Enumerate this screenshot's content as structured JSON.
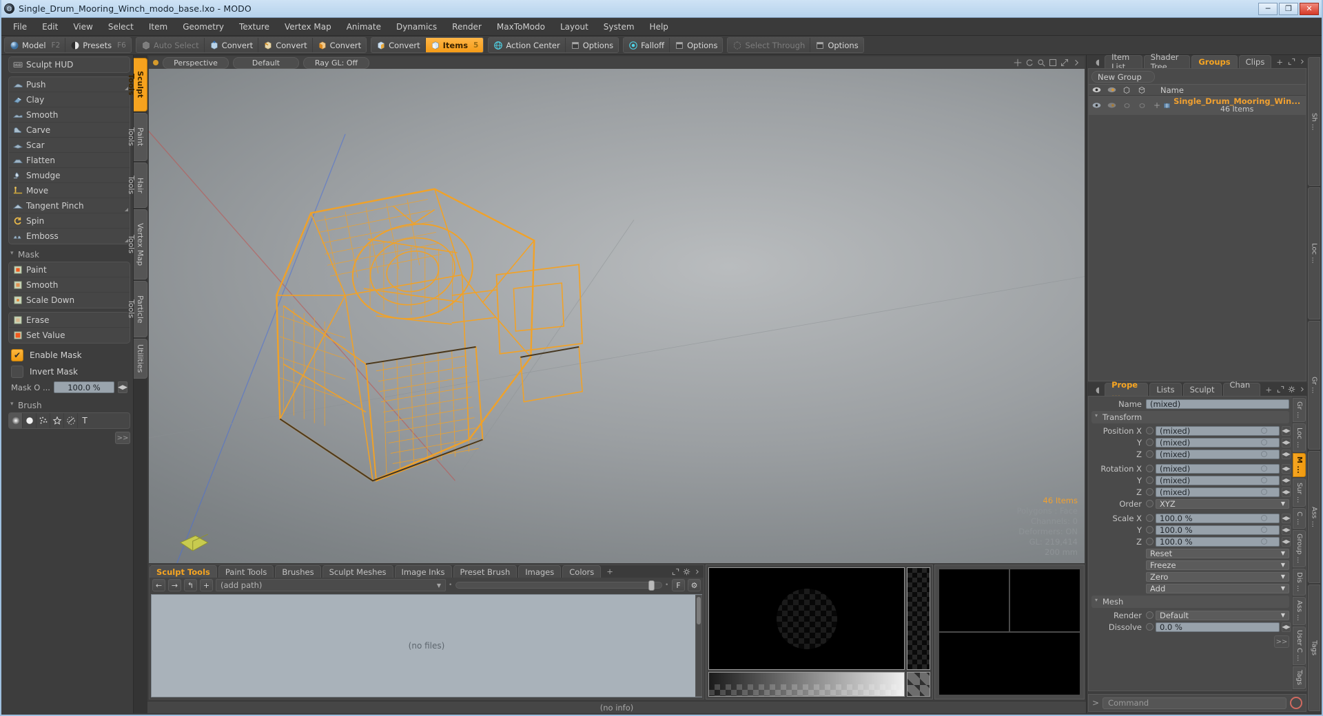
{
  "titlebar": {
    "title": "Single_Drum_Mooring_Winch_modo_base.lxo - MODO",
    "logo_icon": "modo-logo-icon",
    "minimize": "─",
    "maximize": "❐",
    "close": "✕"
  },
  "menubar": {
    "items": [
      "File",
      "Edit",
      "View",
      "Select",
      "Item",
      "Geometry",
      "Texture",
      "Vertex Map",
      "Animate",
      "Dynamics",
      "Render",
      "MaxToModo",
      "Layout",
      "System",
      "Help"
    ]
  },
  "toolbar": {
    "groups": [
      {
        "buttons": [
          {
            "label": "Model",
            "hotkey": "F2",
            "icon": "sphere-blue-icon",
            "state": "normal"
          },
          {
            "label": "Presets",
            "hotkey": "F6",
            "icon": "sphere-half-icon",
            "state": "normal"
          }
        ]
      },
      {
        "buttons": [
          {
            "label": "Auto Select",
            "hotkey": "",
            "icon": "cube-grey-icon",
            "state": "disabled"
          },
          {
            "label": "Convert",
            "hotkey": "",
            "icon": "cube-vertex-icon",
            "state": "normal"
          },
          {
            "label": "Convert",
            "hotkey": "",
            "icon": "cube-edge-icon",
            "state": "normal"
          },
          {
            "label": "Convert",
            "hotkey": "",
            "icon": "cube-poly-icon",
            "state": "normal"
          }
        ]
      },
      {
        "buttons": [
          {
            "label": "Convert",
            "hotkey": "",
            "icon": "cube-item-icon",
            "state": "normal"
          },
          {
            "label": "Items",
            "hotkey": "5",
            "icon": "cube-orange-icon",
            "state": "active"
          }
        ]
      },
      {
        "buttons": [
          {
            "label": "Action Center",
            "hotkey": "",
            "icon": "globe-icon",
            "state": "normal"
          },
          {
            "label": "Options",
            "hotkey": "",
            "icon": "panel-icon",
            "state": "normal"
          }
        ]
      },
      {
        "buttons": [
          {
            "label": "Falloff",
            "hotkey": "",
            "icon": "falloff-icon",
            "state": "normal"
          },
          {
            "label": "Options",
            "hotkey": "",
            "icon": "panel-icon",
            "state": "normal"
          }
        ]
      },
      {
        "buttons": [
          {
            "label": "Select Through",
            "hotkey": "",
            "icon": "select-through-icon",
            "state": "disabled"
          },
          {
            "label": "Options",
            "hotkey": "",
            "icon": "panel-icon",
            "state": "normal"
          }
        ]
      }
    ]
  },
  "left_panel": {
    "hud_button": {
      "label": "Sculpt HUD",
      "icon": "hud-icon"
    },
    "sculpt_tools": [
      {
        "label": "Push",
        "icon": "push-brush-icon",
        "has_corner": true
      },
      {
        "label": "Clay",
        "icon": "clay-brush-icon",
        "has_corner": false
      },
      {
        "label": "Smooth",
        "icon": "smooth-brush-icon",
        "has_corner": false
      },
      {
        "label": "Carve",
        "icon": "carve-brush-icon",
        "has_corner": false
      },
      {
        "label": "Scar",
        "icon": "scar-brush-icon",
        "has_corner": false
      },
      {
        "label": "Flatten",
        "icon": "flatten-brush-icon",
        "has_corner": false
      },
      {
        "label": "Smudge",
        "icon": "smudge-brush-icon",
        "has_corner": false
      },
      {
        "label": "Move",
        "icon": "move-brush-icon",
        "has_corner": false
      },
      {
        "label": "Tangent Pinch",
        "icon": "pinch-brush-icon",
        "has_corner": true
      },
      {
        "label": "Spin",
        "icon": "spin-brush-icon",
        "has_corner": false
      },
      {
        "label": "Emboss",
        "icon": "emboss-brush-icon",
        "has_corner": true
      }
    ],
    "mask_section": {
      "label": "Mask"
    },
    "mask_tools_a": [
      {
        "label": "Paint",
        "icon": "mask-paint-icon"
      },
      {
        "label": "Smooth",
        "icon": "mask-smooth-icon"
      },
      {
        "label": "Scale Down",
        "icon": "mask-scaledown-icon"
      }
    ],
    "mask_tools_b": [
      {
        "label": "Erase",
        "icon": "mask-erase-icon"
      },
      {
        "label": "Set Value",
        "icon": "mask-setvalue-icon"
      }
    ],
    "enable_mask": {
      "label": "Enable Mask",
      "checked": true,
      "check_glyph": "✔"
    },
    "invert_mask": {
      "label": "Invert Mask",
      "checked": false,
      "check_glyph": ""
    },
    "mask_opacity": {
      "label": "Mask O ...",
      "value": "100.0 %"
    },
    "brush_section": {
      "label": "Brush"
    },
    "brush_icons": [
      {
        "name": "soft-falloff-icon",
        "glyph": "●",
        "selected": true
      },
      {
        "name": "hard-falloff-icon",
        "glyph": "⬤",
        "selected": false
      },
      {
        "name": "noise-brush-icon",
        "glyph": "❋",
        "selected": false
      },
      {
        "name": "star-brush-icon",
        "glyph": "☆",
        "selected": false
      },
      {
        "name": "procedural-brush-icon",
        "glyph": "◓",
        "selected": false
      },
      {
        "name": "text-brush-icon",
        "glyph": "T",
        "selected": false
      }
    ],
    "more_button": ">>",
    "vertical_tabs": [
      {
        "label": "Sculpt Tools",
        "active": true
      },
      {
        "label": "Paint Tools",
        "active": false
      },
      {
        "label": "Hair Tools",
        "active": false
      },
      {
        "label": "Vertex Map Tools",
        "active": false
      },
      {
        "label": "Particle Tools",
        "active": false
      },
      {
        "label": "Utilities",
        "active": false
      }
    ]
  },
  "viewport": {
    "header": {
      "dot_icon": "viewport-menu-dot-icon",
      "pills": [
        "Perspective",
        "Default",
        "Ray GL: Off"
      ],
      "icons": [
        "move-view-icon",
        "rotate-view-icon",
        "zoom-view-icon",
        "fit-view-icon",
        "maximize-icon",
        "gear-icon",
        "arrow-right-icon"
      ]
    },
    "hud_lines": [
      "46 Items",
      "Polygons : Face",
      "Channels: 0",
      "Deformers: ON",
      "GL: 219,414",
      "200 mm"
    ],
    "model_color": "#f4a224",
    "axis_colors": {
      "x": "#c0504d",
      "y": "#4a6fd8",
      "z": "#6aa84f"
    }
  },
  "bottom_panel": {
    "tabs": [
      {
        "label": "Sculpt Tools",
        "active": true
      },
      {
        "label": "Paint Tools",
        "active": false
      },
      {
        "label": "Brushes",
        "active": false
      },
      {
        "label": "Sculpt Meshes",
        "active": false
      },
      {
        "label": "Image Inks",
        "active": false
      },
      {
        "label": "Preset Brush",
        "active": false
      },
      {
        "label": "Images",
        "active": false
      },
      {
        "label": "Colors",
        "active": false
      },
      {
        "label": "+",
        "active": false
      }
    ],
    "toolrow": {
      "back_icon": "arrow-left-icon",
      "forward_icon": "arrow-right-icon",
      "up_icon": "arrow-up-folder-icon",
      "add_icon": "plus-icon",
      "path_value": "(add path)",
      "size_label": "F",
      "gear_icon": "gear-icon"
    },
    "file_area_message": "(no files)",
    "status": "(no info)",
    "header_icons": [
      "maximize-icon",
      "gear-icon",
      "arrow-right-icon"
    ]
  },
  "right_panel": {
    "top_tabs": [
      {
        "label": "Item List",
        "active": false
      },
      {
        "label": "Shader Tree",
        "active": false
      },
      {
        "label": "Groups",
        "active": true
      },
      {
        "label": "Clips",
        "active": false
      },
      {
        "label": "+",
        "active": false
      }
    ],
    "top_icons": [
      "maximize-icon",
      "arrow-right-icon"
    ],
    "new_group_button": "New Group",
    "list_header": {
      "col_icons": [
        "eye-icon",
        "render-visibility-icon",
        "wireframe-cube-icon",
        "shaded-cube-icon"
      ],
      "name_column": "Name"
    },
    "list_rows": [
      {
        "name": "Single_Drum_Mooring_Win...",
        "sub": "46 Items",
        "item_icon": "group-item-icon",
        "expand": "+"
      }
    ],
    "prop_tabs": [
      {
        "label": "Prope ...",
        "active": true
      },
      {
        "label": "Lists",
        "active": false
      },
      {
        "label": "Sculpt",
        "active": false
      },
      {
        "label": "Chan ...",
        "active": false
      },
      {
        "label": "+",
        "active": false
      }
    ],
    "prop_icons": [
      "maximize-icon",
      "gear-icon",
      "arrow-right-icon"
    ],
    "name_row": {
      "label": "Name",
      "value": "(mixed)"
    },
    "transform_section": "Transform",
    "transform_rows": [
      {
        "label": "Position X",
        "value": "(mixed)",
        "type": "num"
      },
      {
        "label": "Y",
        "value": "(mixed)",
        "type": "num"
      },
      {
        "label": "Z",
        "value": "(mixed)",
        "type": "num"
      },
      {
        "label": "Rotation X",
        "value": "(mixed)",
        "type": "num"
      },
      {
        "label": "Y",
        "value": "(mixed)",
        "type": "num"
      },
      {
        "label": "Z",
        "value": "(mixed)",
        "type": "num"
      },
      {
        "label": "Order",
        "value": "XYZ",
        "type": "select"
      },
      {
        "label": "Scale X",
        "value": "100.0 %",
        "type": "num"
      },
      {
        "label": "Y",
        "value": "100.0 %",
        "type": "num"
      },
      {
        "label": "Z",
        "value": "100.0 %",
        "type": "num"
      }
    ],
    "transform_actions": [
      {
        "value": "Reset"
      },
      {
        "value": "Freeze"
      },
      {
        "value": "Zero"
      },
      {
        "value": "Add"
      }
    ],
    "mesh_section": "Mesh",
    "mesh_rows": [
      {
        "label": "Render",
        "value": "Default",
        "type": "select"
      },
      {
        "label": "Dissolve",
        "value": "0.0 %",
        "type": "num"
      }
    ],
    "more_button": ">>",
    "side_tabs": [
      {
        "label": "Gr ...",
        "active": false
      },
      {
        "label": "Loc ...",
        "active": false
      },
      {
        "label": "M ...",
        "active": true
      },
      {
        "label": "Sur ...",
        "active": false
      },
      {
        "label": "C ...",
        "active": false
      },
      {
        "label": "Group ...",
        "active": false
      },
      {
        "label": "Dis ...",
        "active": false
      },
      {
        "label": "Ass ...",
        "active": false
      },
      {
        "label": "User C ...",
        "active": false
      },
      {
        "label": "Tags",
        "active": false
      }
    ],
    "command_bar": {
      "prompt": ">",
      "placeholder": "Command",
      "record_icon": "record-icon"
    }
  },
  "right_edge_tabs": [
    "Sh ...",
    "Loc ...",
    "Gr ...",
    "Ass ...",
    "Tags"
  ],
  "colors": {
    "accent": "#f7a521",
    "panel_bg": "#3d3d3d",
    "field_bg": "#98a2ab",
    "model_orange": "#f4a224"
  }
}
